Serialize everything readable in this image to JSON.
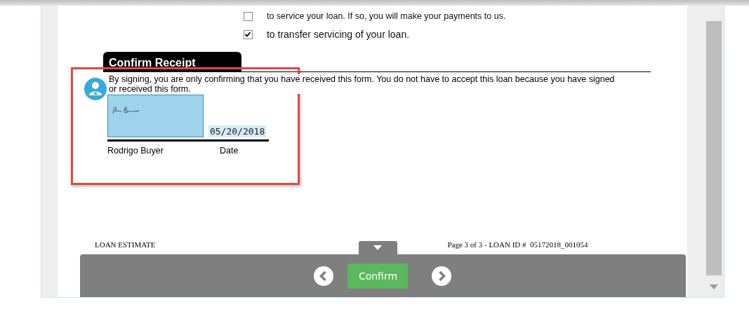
{
  "options": [
    {
      "label": "to service your loan. If so, you will make your payments to us.",
      "checked": false
    },
    {
      "label": "to transfer servicing of your loan.",
      "checked": true
    }
  ],
  "section": {
    "title": "Confirm Receipt",
    "notice": "By signing, you are only confirming that you have received this form. You do not have to accept this loan because you have signed or received this form."
  },
  "signature": {
    "signed": true,
    "date": "05/20/2018",
    "signer_label": "Rodrigo Buyer",
    "date_label": "Date",
    "highlighted": true
  },
  "footer": {
    "left": "LOAN ESTIMATE",
    "right": "Page 3 of 3 - LOAN ID #  05172018_001054"
  },
  "toolbar": {
    "confirm_button": "Confirm"
  }
}
